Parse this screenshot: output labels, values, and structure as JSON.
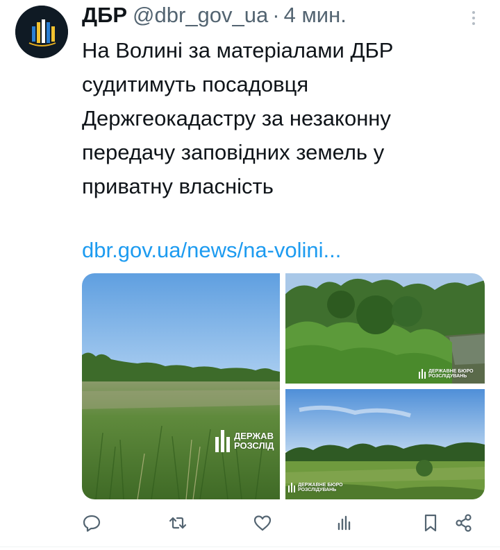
{
  "tweet": {
    "author_name": "ДБР",
    "handle": "@dbr_gov_ua",
    "separator": "·",
    "time": "4 мин.",
    "text": "На Волині за матеріалами ДБР\nсудитимуть посадовця\nДержгеокадастру за незаконну\nпередачу заповідних земель у\nприватну власність",
    "link": "dbr.gov.ua/news/na-volini..."
  },
  "media": {
    "watermark_line1": "ДЕРЖАВНЕ БЮРО",
    "watermark_line2": "РОЗСЛІДУВАНЬ",
    "watermark_large_line1": "ДЕРЖАВ",
    "watermark_large_line2": "РОЗСЛІД"
  },
  "icons": {
    "more": "more-vertical-icon",
    "reply": "reply-icon",
    "retweet": "retweet-icon",
    "like": "like-icon",
    "views": "views-icon",
    "bookmark": "bookmark-icon",
    "share": "share-icon"
  },
  "colors": {
    "text": "#0f1419",
    "secondary": "#536471",
    "link": "#1d9bf0",
    "icon": "#536471"
  }
}
